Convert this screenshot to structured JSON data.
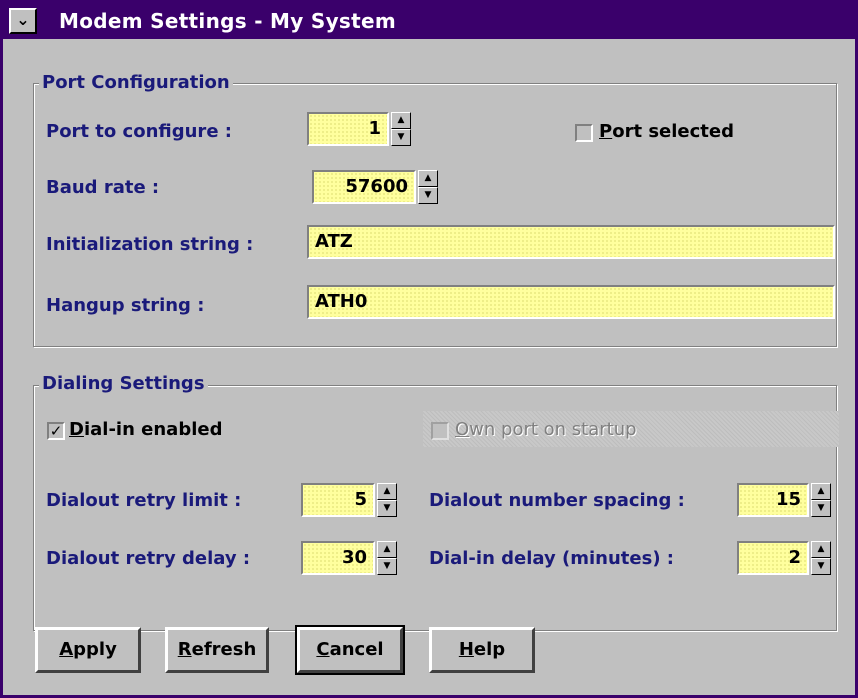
{
  "window": {
    "title": "Modem Settings - My System",
    "sysmenu_glyph": "⌄"
  },
  "port_config": {
    "group_label": "Port Configuration",
    "port_label": "Port to configure :",
    "port_value": "1",
    "port_selected_label": "Port selected",
    "port_selected_checked": false,
    "baud_label": "Baud rate :",
    "baud_value": "57600",
    "init_label": "Initialization string :",
    "init_value": "ATZ",
    "hangup_label": "Hangup string :",
    "hangup_value": "ATH0"
  },
  "dialing": {
    "group_label": "Dialing Settings",
    "dialin_enabled_label": "Dial-in enabled",
    "dialin_enabled_checked": true,
    "own_port_label": "Own port on startup",
    "own_port_enabled": false,
    "retry_limit_label": "Dialout retry limit :",
    "retry_limit_value": "5",
    "number_spacing_label": "Dialout number spacing :",
    "number_spacing_value": "15",
    "retry_delay_label": "Dialout retry delay :",
    "retry_delay_value": "30",
    "dialin_delay_label": "Dial-in delay (minutes) :",
    "dialin_delay_value": "2"
  },
  "buttons": {
    "apply": "Apply",
    "refresh": "Refresh",
    "cancel": "Cancel",
    "help": "Help"
  },
  "glyphs": {
    "up": "▲",
    "down": "▼",
    "check": "✓"
  },
  "colors": {
    "title_bar": "#3a006b",
    "field_bg": "#ffff9e",
    "label_text": "#1a1a7a",
    "face": "#c0c0c0"
  }
}
